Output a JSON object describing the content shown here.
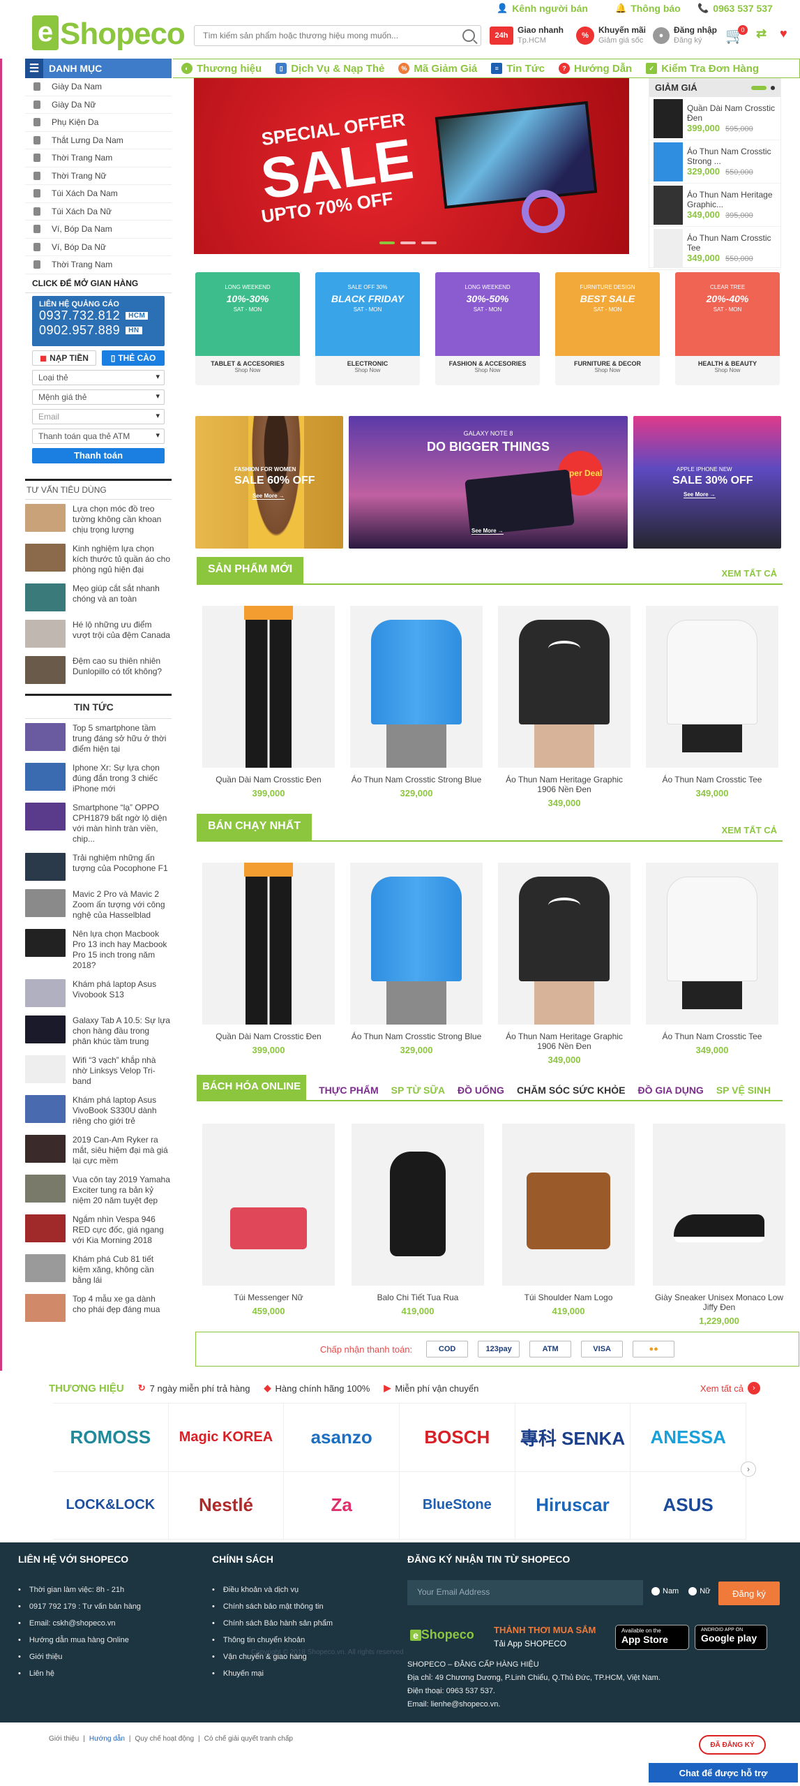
{
  "topbar": {
    "seller_channel": "Kênh người bán",
    "notifications": "Thông báo",
    "hotline": "0963 537 537"
  },
  "logo": {
    "letter": "e",
    "name": "Shopeco"
  },
  "search": {
    "placeholder": "Tìm kiếm sản phẩm hoặc thương hiệu mong muốn..."
  },
  "header_features": [
    {
      "title": "Giao nhanh",
      "subtitle": "Tp.HCM"
    },
    {
      "title": "Khuyến mãi",
      "subtitle": "Giảm giá sốc"
    },
    {
      "title": "Đăng nhập",
      "subtitle": "Đăng ký"
    }
  ],
  "cart": {
    "count": "0"
  },
  "category_header": "DANH MỤC",
  "nav": {
    "items": [
      "Thương hiệu",
      "Dịch Vụ & Nạp Thẻ",
      "Mã Giảm Giá",
      "Tin Tức",
      "Hướng Dẫn",
      "Kiểm Tra Đơn Hàng"
    ]
  },
  "categories": [
    "Giày Da Nam",
    "Giày Da Nữ",
    "Phụ Kiện Da",
    "Thắt Lưng Da Nam",
    "Thời Trang Nam",
    "Thời Trang Nữ",
    "Túi Xách Da Nam",
    "Túi Xách Da Nữ",
    "Ví, Bóp Da Nam",
    "Ví, Bóp Da Nữ",
    "Thời Trang Nam"
  ],
  "store_cta": "CLICK ĐỂ MỞ GIAN HÀNG",
  "ad": {
    "title": "LIÊN HỆ QUẢNG CÁO",
    "phone1": "0937.732.812",
    "tag1": "HCM",
    "phone2": "0902.957.889",
    "tag2": "HN"
  },
  "topup": {
    "tab_topup": "NẠP TIỀN",
    "tab_card": "THẺ CÀO",
    "card_type": "Loại thẻ",
    "card_value": "Mệnh giá thẻ",
    "email_placeholder": "Email",
    "payment_method": "Thanh toán qua thẻ ATM",
    "pay_button": "Thanh toán"
  },
  "advice": {
    "title": "TƯ VẤN TIÊU DÙNG",
    "items": [
      "Lựa chọn móc đồ treo tường không cần khoan chịu trọng lượng",
      "Kinh nghiệm lựa chọn kích thước tủ quần áo cho phòng ngủ hiện đại",
      "Mẹo giúp cắt sắt nhanh chóng và an toàn",
      "Hé lộ những ưu điểm vượt trội của đệm Canada",
      "Đệm cao su thiên nhiên Dunlopillo có tốt không?"
    ]
  },
  "news": {
    "title": "TIN TỨC",
    "items": [
      "Top 5 smartphone tầm trung đáng sở hữu ở thời điểm hiện tại",
      "Iphone Xr: Sự lựa chọn đúng đắn trong 3 chiếc iPhone mới",
      "Smartphone “lạ” OPPO CPH1879 bất ngờ lộ diện với màn hình tràn viền, chip...",
      "Trải nghiệm những ấn tượng của Pocophone F1",
      "Mavic 2 Pro và Mavic 2 Zoom ấn tượng với công nghệ của Hasselblad",
      "Nên lựa chọn Macbook Pro 13 inch hay Macbook Pro 15 inch trong năm 2018?",
      "Khám phá laptop Asus Vivobook S13",
      "Galaxy Tab A 10.5: Sự lựa chọn hàng đầu trong phân khúc tầm trung",
      "Wifi “3 vạch” khắp nhà nhờ Linksys Velop Tri-band",
      "Khám phá laptop Asus VivoBook S330U dành riêng cho giới trẻ",
      "2019 Can-Am Ryker ra mắt, siêu hiệm đại mà giá lại cực mềm",
      "Vua côn tay 2019 Yamaha Exciter tung ra bản kỷ niệm 20 năm tuyệt đẹp",
      "Ngắm nhìn Vespa 946 RED cực đốc, giá ngang với Kia Morning 2018",
      "Khám phá Cub 81 tiết kiệm xăng, không cần bằng lái",
      "Top 4 mẫu xe ga dành cho phái đẹp đáng mua"
    ]
  },
  "slider": {
    "line1": "SPECIAL OFFER",
    "line2": "SALE",
    "line3": "UPTO 70% OFF"
  },
  "price_box": {
    "title": "GIẢM GIÁ",
    "items": [
      {
        "name": "Quần Dài Nam Crosstic Đen",
        "price": "399,000",
        "old": "595,000"
      },
      {
        "name": "Áo Thun Nam Crosstic Strong ...",
        "price": "329,000",
        "old": "550,000"
      },
      {
        "name": "Áo Thun Nam Heritage Graphic...",
        "price": "349,000",
        "old": "395,000"
      },
      {
        "name": "Áo Thun Nam Crosstic Tee",
        "price": "349,000",
        "old": "550,000"
      }
    ]
  },
  "promo_tiles": [
    {
      "headline": "10%-30%",
      "sub": "LONG WEEKEND",
      "days": "SAT - MON",
      "label": "TABLET & ACCESORIES",
      "cta": "Shop Now",
      "color": "#3dbd8b"
    },
    {
      "headline": "BLACK FRIDAY",
      "sub": "SALE OFF 30%",
      "days": "SAT - MON",
      "label": "ELECTRONIC",
      "cta": "Shop Now",
      "color": "#3aa4e8"
    },
    {
      "headline": "30%-50%",
      "sub": "LONG WEEKEND",
      "days": "SAT - MON",
      "label": "FASHION & ACCESORIES",
      "cta": "Shop Now",
      "color": "#8a5cd0"
    },
    {
      "headline": "BEST SALE",
      "sub": "FURNITURE DESIGN",
      "days": "SAT - MON",
      "label": "FURNITURE & DECOR",
      "cta": "Shop Now",
      "color": "#f3a93a"
    },
    {
      "headline": "20%-40%",
      "sub": "CLEAR TREE",
      "days": "SAT - MON",
      "label": "HEALTH & BEAUTY",
      "cta": "Shop Now",
      "color": "#f06454"
    }
  ],
  "banners": [
    {
      "kicker": "FASHION FOR WOMEN",
      "headline": "SALE 60% OFF",
      "cta": "See More →"
    },
    {
      "kicker": "GALAXY NOTE 8",
      "headline": "DO BIGGER THINGS",
      "badge": "Super Deal",
      "cta": "See More →"
    },
    {
      "kicker": "APPLE IPHONE NEW",
      "headline": "SALE 30% OFF",
      "cta": "See More →"
    }
  ],
  "new_products": {
    "title": "SẢN PHẨM MỚI",
    "more": "XEM TẤT CẢ",
    "items": [
      {
        "name": "Quần Dài Nam Crosstic Đen",
        "price": "399,000"
      },
      {
        "name": "Áo Thun Nam Crosstic Strong Blue",
        "price": "329,000"
      },
      {
        "name": "Áo Thun Nam Heritage Graphic 1906 Nền Đen",
        "price": "349,000"
      },
      {
        "name": "Áo Thun Nam Crosstic Tee",
        "price": "349,000"
      }
    ]
  },
  "best_sellers": {
    "title": "BÁN CHẠY NHẤT",
    "more": "XEM TẤT CẢ",
    "items": [
      {
        "name": "Quần Dài Nam Crosstic Đen",
        "price": "399,000"
      },
      {
        "name": "Áo Thun Nam Crosstic Strong Blue",
        "price": "329,000"
      },
      {
        "name": "Áo Thun Nam Heritage Graphic 1906 Nền Đen",
        "price": "349,000"
      },
      {
        "name": "Áo Thun Nam Crosstic Tee",
        "price": "349,000"
      }
    ]
  },
  "online_grocery": {
    "title": "BÁCH HÓA ONLINE",
    "tabs": [
      {
        "label": "THỰC PHẨM",
        "color": "#7b2d8b"
      },
      {
        "label": "SP TỪ SỮA",
        "color": "#8cc63f"
      },
      {
        "label": "ĐỒ UỐNG",
        "color": "#7b2d8b"
      },
      {
        "label": "CHĂM SÓC SỨC KHỎE",
        "color": "#333333"
      },
      {
        "label": "ĐỒ GIA DỤNG",
        "color": "#7b2d8b"
      },
      {
        "label": "SP VỆ SINH",
        "color": "#8cc63f"
      }
    ],
    "items": [
      {
        "name": "Túi Messenger Nữ",
        "price": "459,000"
      },
      {
        "name": "Balo Chi Tiết Tua Rua",
        "price": "419,000"
      },
      {
        "name": "Túi Shoulder Nam Logo",
        "price": "419,000"
      },
      {
        "name": "Giày Sneaker Unisex Monaco Low Jiffy Đen",
        "price": "1,229,000"
      }
    ]
  },
  "payment": {
    "label": "Chấp nhận thanh toán:",
    "methods": [
      "COD",
      "123pay",
      "ATM",
      "VISA",
      "●●"
    ]
  },
  "brands": {
    "title": "THƯƠNG HIỆU",
    "features": [
      "7 ngày miễn phí trả hàng",
      "Hàng chính hãng 100%",
      "Miễn phí vận chuyển"
    ],
    "more": "Xem tất cả",
    "logos": [
      {
        "name": "ROMOSS",
        "color": "#1e8a9a"
      },
      {
        "name": "Magic KOREA",
        "color": "#d92027"
      },
      {
        "name": "asanzo",
        "color": "#1d6fc2"
      },
      {
        "name": "BOSCH",
        "color": "#d92027"
      },
      {
        "name": "專科 SENKA",
        "color": "#1b3f8a"
      },
      {
        "name": "ANESSA",
        "color": "#1aa0d8"
      },
      {
        "name": "LOCK&LOCK",
        "color": "#1d4fa0"
      },
      {
        "name": "Nestlé",
        "color": "#b02a2a"
      },
      {
        "name": "Za",
        "color": "#e0306a"
      },
      {
        "name": "BlueStone",
        "color": "#1d5fb0"
      },
      {
        "name": "Hiruscar",
        "color": "#1a66b8"
      },
      {
        "name": "ASUS",
        "color": "#1b4a9a"
      }
    ]
  },
  "footer": {
    "contact_title": "LIÊN HỆ VỚI SHOPECO",
    "contact": [
      "Thời gian làm việc: 8h - 21h",
      "0917 792 179 : Tư vấn bán hàng",
      "Email: cskh@shopeco.vn",
      "Hướng dẫn mua hàng Online",
      "Giới thiệu",
      "Liên hệ"
    ],
    "policy_title": "CHÍNH SÁCH",
    "policy": [
      "Điều khoản và dịch vụ",
      "Chính sách bảo mật thông tin",
      "Chính sách Bảo hành sản phẩm",
      "Thông tin chuyển khoản",
      "Vận chuyển & giao hàng",
      "Khuyến mại"
    ],
    "newsletter_title": "ĐĂNG KÝ NHẬN TIN TỪ SHOPECO",
    "email_placeholder": "Your Email Address",
    "gender_male": "Nam",
    "gender_female": "Nữ",
    "register": "Đăng ký",
    "slogan": "THẢNH THƠI MUA SẮM",
    "app_label": "Tải App SHOPECO",
    "appstore_small": "Available on the",
    "appstore": "App Store",
    "googleplay_small": "ANDROID APP ON",
    "googleplay": "Google play",
    "company": "SHOPECO – ĐẲNG CẤP HÀNG HIỆU",
    "address": "Địa chỉ: 49 Chương Dương, P.Linh Chiểu, Q.Thủ Đức, TP.HCM, Việt Nam.",
    "phone": "Điện thoại: 0963 537 537.",
    "email": "Email: lienhe@shopeco.vn.",
    "copyright": "Copyright © 2018 Shopeco.vn. All rights reserved"
  },
  "bottom": {
    "links": [
      "Giới thiệu",
      "Hướng dẫn",
      "Quy chế hoạt động",
      "Có chế giải quyết tranh chấp"
    ],
    "verified": "ĐÃ ĐĂNG KÝ",
    "chat": "Chat để được hỗ trợ"
  }
}
